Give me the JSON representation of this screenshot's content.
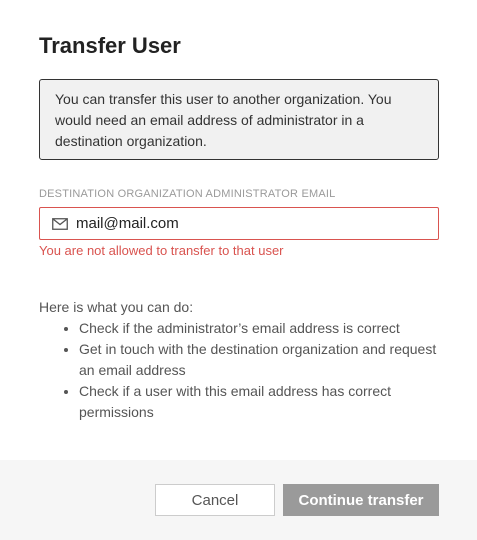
{
  "dialog": {
    "title": "Transfer User",
    "info": "You can transfer this user to another organization. You would need an email address of administrator in a destination organization.",
    "field_label": "Destination organization administrator email",
    "email_value": "mail@mail.com",
    "email_icon": "mail-icon",
    "error": "You are not allowed to transfer to that user",
    "help_intro": "Here is what you can do:",
    "help_items": [
      "Check if the administrator’s email address is correct",
      "Get in touch with the destination organization and request an email address",
      "Check if a user with this email address has correct permissions"
    ],
    "cancel_label": "Cancel",
    "continue_label": "Continue transfer"
  },
  "colors": {
    "error": "#d9534f",
    "disabled_button": "#9a9a9a",
    "info_background": "#f1f1f1"
  }
}
